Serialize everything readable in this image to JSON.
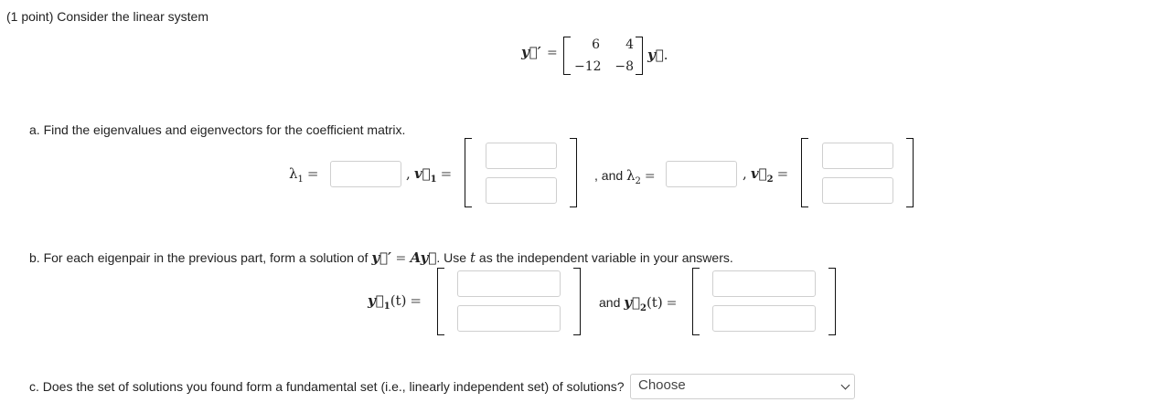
{
  "header": {
    "points": "(1 point)",
    "prompt": "Consider the linear system"
  },
  "system": {
    "lhs": "y⃗′",
    "equals": "=",
    "matrix": [
      [
        "6",
        "4"
      ],
      [
        "−12",
        "−8"
      ]
    ],
    "rhs": "y⃗",
    "period": "."
  },
  "part_a": {
    "text": "a. Find the eigenvalues and eigenvectors for the coefficient matrix.",
    "lambda1": "λ",
    "lambda1_sub": "1",
    "v1": "v⃗",
    "v1_sub": "1",
    "and_text": ", and ",
    "lambda2": "λ",
    "lambda2_sub": "2",
    "v2": "v⃗",
    "v2_sub": "2",
    "comma": ",",
    "equals": "="
  },
  "part_b": {
    "text_before": "b. For each eigenpair in the previous part, form a solution of ",
    "yprime": "y⃗′",
    "eq": " = ",
    "Ay": "Ay⃗",
    "text_mid": ". Use ",
    "t": "t",
    "text_after": " as the independent variable in your answers.",
    "y1": "y⃗",
    "y1_sub": "1",
    "arg": "(t)",
    "and_text": "and ",
    "y2": "y⃗",
    "y2_sub": "2",
    "equals": "="
  },
  "part_c": {
    "text": "c. Does the set of solutions you found form a fundamental set (i.e., linearly independent set) of solutions?",
    "select_value": "Choose"
  }
}
